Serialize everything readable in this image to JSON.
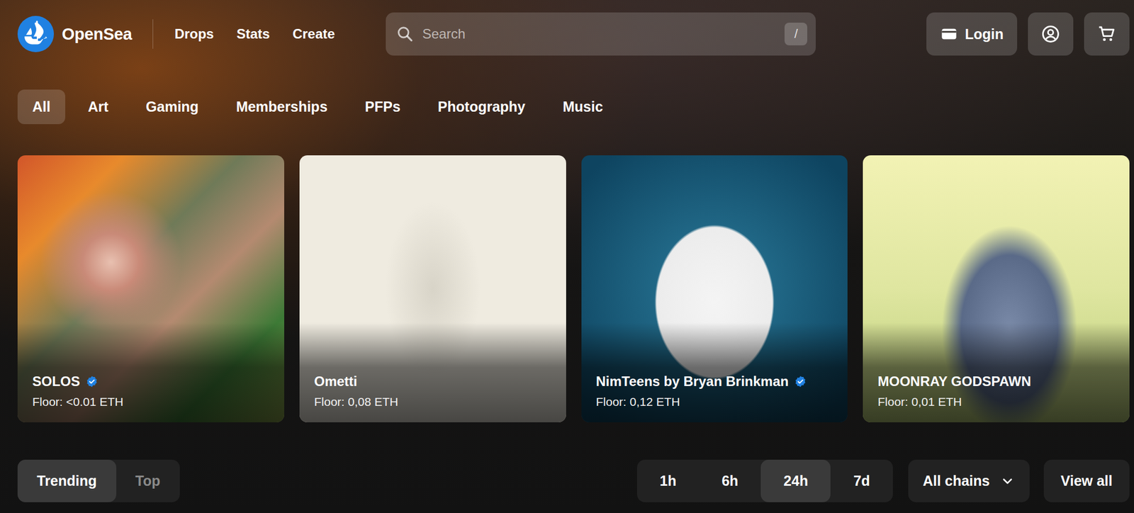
{
  "logo": {
    "text": "OpenSea"
  },
  "nav": [
    {
      "label": "Drops"
    },
    {
      "label": "Stats"
    },
    {
      "label": "Create"
    }
  ],
  "search": {
    "placeholder": "Search",
    "shortcut": "/"
  },
  "actions": {
    "login": "Login"
  },
  "categories": [
    {
      "label": "All",
      "selected": true
    },
    {
      "label": "Art",
      "selected": false
    },
    {
      "label": "Gaming",
      "selected": false
    },
    {
      "label": "Memberships",
      "selected": false
    },
    {
      "label": "PFPs",
      "selected": false
    },
    {
      "label": "Photography",
      "selected": false
    },
    {
      "label": "Music",
      "selected": false
    }
  ],
  "collections": [
    {
      "name": "SOLOS",
      "verified": true,
      "floor": "Floor: <0.01 ETH"
    },
    {
      "name": "Ometti",
      "verified": false,
      "floor": "Floor: 0,08 ETH"
    },
    {
      "name": "NimTeens by Bryan Brinkman",
      "verified": true,
      "floor": "Floor: 0,12 ETH"
    },
    {
      "name": "MOONRAY GODSPAWN",
      "verified": false,
      "floor": "Floor: 0,01 ETH"
    }
  ],
  "view_toggle": [
    {
      "label": "Trending",
      "selected": true
    },
    {
      "label": "Top",
      "selected": false
    }
  ],
  "time_ranges": [
    {
      "label": "1h",
      "selected": false
    },
    {
      "label": "6h",
      "selected": false
    },
    {
      "label": "24h",
      "selected": true
    },
    {
      "label": "7d",
      "selected": false
    }
  ],
  "chain_filter": {
    "label": "All chains"
  },
  "view_all": "View all"
}
